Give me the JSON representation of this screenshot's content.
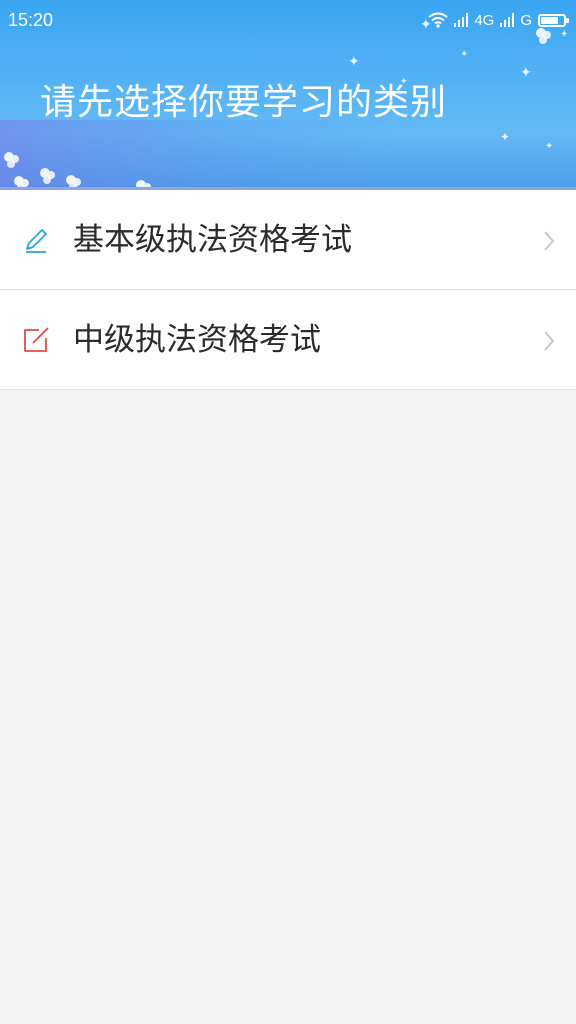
{
  "status_bar": {
    "time": "15:20",
    "network_primary": "4G",
    "network_secondary": "G",
    "battery_level": 0.75,
    "icons": [
      "wifi-icon",
      "signal-icon",
      "signal-icon",
      "battery-icon"
    ]
  },
  "header": {
    "title": "请先选择你要学习的类别"
  },
  "categories": [
    {
      "label": "基本级执法资格考试",
      "icon": "pencil-icon",
      "icon_color": "#2fa0d8"
    },
    {
      "label": "中级执法资格考试",
      "icon": "edit-square-icon",
      "icon_color": "#e04a4a"
    }
  ],
  "colors": {
    "header_blue": "#4fb0f4",
    "background": "#f4f4f4",
    "chevron": "#c4c4c4"
  }
}
